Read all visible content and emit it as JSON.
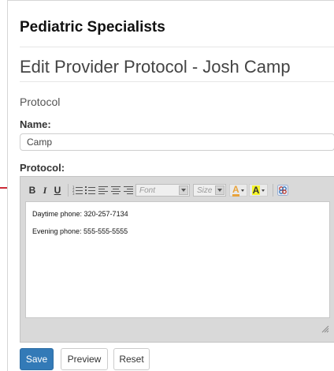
{
  "header": {
    "org_name": "Pediatric Specialists",
    "page_title": "Edit Provider Protocol - Josh Camp"
  },
  "form": {
    "section_title": "Protocol",
    "name_label": "Name:",
    "name_value": "Camp",
    "protocol_label": "Protocol:"
  },
  "editor": {
    "toolbar": {
      "bold": "B",
      "italic": "I",
      "underline": "U",
      "font_select": "Font",
      "size_select": "Size",
      "text_color_glyph": "A",
      "bg_color_glyph": "A",
      "text_color": "#e8a33c",
      "bg_color": "#f5f52a",
      "icons": [
        "ordered-list-icon",
        "unordered-list-icon",
        "align-left-icon",
        "align-center-icon",
        "align-right-icon",
        "source-toggle-icon",
        "resize-grip-icon"
      ]
    },
    "content": [
      "Daytime phone: 320-257-7134",
      "Evening phone: 555-555-5555"
    ]
  },
  "actions": {
    "save_label": "Save",
    "preview_label": "Preview",
    "reset_label": "Reset"
  },
  "colors": {
    "primary": "#337ab7",
    "accent_marker": "#cc2a36"
  }
}
